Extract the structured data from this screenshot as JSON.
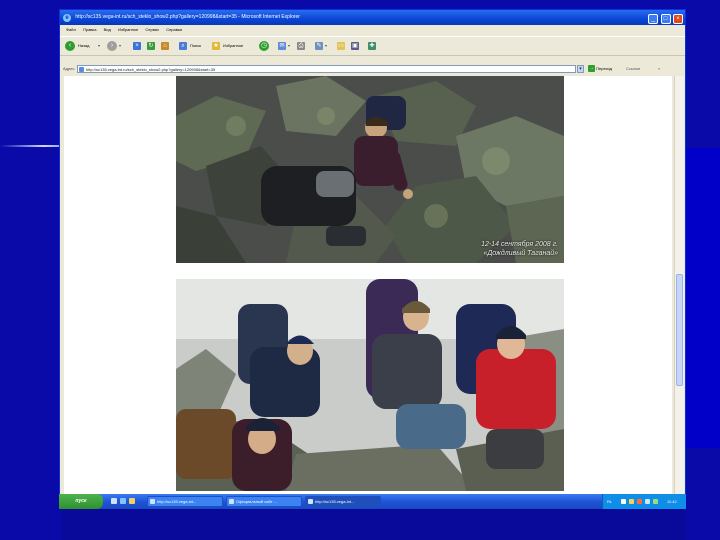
{
  "browser": {
    "title": "http://sc135.vega-int.ru/sch_steklo_show2.php?gallery=120998&start=35 - Microsoft Internet Explorer",
    "window_buttons": [
      "_",
      "□",
      "×"
    ],
    "menu": [
      "Файл",
      "Правка",
      "Вид",
      "Избранное",
      "Сервис",
      "Справка"
    ],
    "toolbar": {
      "back_label": "Назад",
      "search_label": "Поиск",
      "favorites_label": "Избранное"
    },
    "address": {
      "label": "Адрес",
      "url": "http://sc135.vega-int.ru/sch_steklo_show2.php?gallery=120998&start=35",
      "go_label": "Переход",
      "links_label": "Ссылки",
      "extra_glyph": "»"
    },
    "status": {
      "text": "Готово",
      "zone": "Интернет"
    }
  },
  "photos": [
    {
      "caption_line1": "12-14 сентября 2008 г.",
      "caption_line2": "«Дождливый Таганай»"
    },
    {}
  ],
  "taskbar": {
    "start_label": "пуск",
    "items": [
      "http://sc135.vega-int...",
      "Официальный сайт ...",
      "http://sc135.vega-int..."
    ],
    "tray": {
      "lang": "RL",
      "time": "11:42"
    }
  },
  "colors": {
    "background": "#0a0aa8",
    "titlebar": "#0a46d6",
    "taskbar": "#1f55d8",
    "start_button": "#2f8f2f"
  }
}
